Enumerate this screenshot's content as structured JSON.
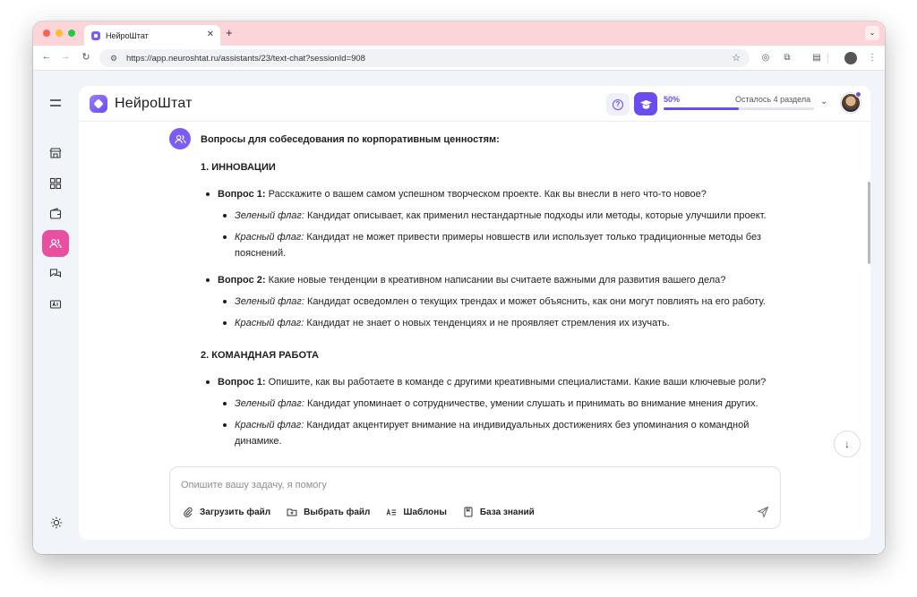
{
  "browser": {
    "tab_title": "НейроШтат",
    "url": "https://app.neuroshtat.ru/assistants/23/text-chat?sessionId=908"
  },
  "header": {
    "brand": "НейроШтат",
    "progress_percent_label": "50%",
    "progress_value": 0.5,
    "progress_remaining": "Осталось 4 раздела"
  },
  "sidebar": {
    "items": [
      {
        "icon": "store-icon"
      },
      {
        "icon": "grid-icon"
      },
      {
        "icon": "wallet-icon"
      },
      {
        "icon": "users-icon",
        "active": true
      },
      {
        "icon": "chat-icon"
      },
      {
        "icon": "id-card-icon"
      }
    ],
    "theme_icon": "sun-icon"
  },
  "message": {
    "title": "Вопросы для собеседования по корпоративным ценностям:",
    "sections": [
      {
        "title": "1. ИННОВАЦИИ",
        "questions": [
          {
            "label": "Вопрос 1:",
            "text": " Расскажите о вашем самом успешном творческом проекте. Как вы внесли в него что-то новое?",
            "green_label": "Зеленый флаг:",
            "green_text": " Кандидат описывает, как применил нестандартные подходы или методы, которые улучшили проект.",
            "red_label": "Красный флаг:",
            "red_text": " Кандидат не может привести примеры новшеств или использует только традиционные методы без пояснений."
          },
          {
            "label": "Вопрос 2:",
            "text": " Какие новые тенденции в креативном написании вы считаете важными для развития вашего дела?",
            "green_label": "Зеленый флаг:",
            "green_text": " Кандидат осведомлен о текущих трендах и может объяснить, как они могут повлиять на его работу.",
            "red_label": "Красный флаг:",
            "red_text": " Кандидат не знает о новых тенденциях и не проявляет стремления их изучать."
          }
        ]
      },
      {
        "title": "2. КОМАНДНАЯ РАБОТА",
        "questions": [
          {
            "label": "Вопрос 1:",
            "text": " Опишите, как вы работаете в команде с другими креативными специалистами. Какие ваши ключевые роли?",
            "green_label": "Зеленый флаг:",
            "green_text": " Кандидат упоминает о сотрудничестве, умении слушать и принимать во внимание мнения других.",
            "red_label": "Красный флаг:",
            "red_text": " Кандидат акцентирует внимание на индивидуальных достижениях без упоминания о командной динамике."
          }
        ]
      }
    ]
  },
  "composer": {
    "placeholder": "Опишите вашу задачу, я помогу",
    "upload_label": "Загрузить файл",
    "choose_label": "Выбрать файл",
    "templates_label": "Шаблоны",
    "knowledge_label": "База знаний"
  },
  "colors": {
    "accent": "#6a4cf0",
    "active_nav": "#e94fa0",
    "tabstrip": "#fcd5da"
  }
}
